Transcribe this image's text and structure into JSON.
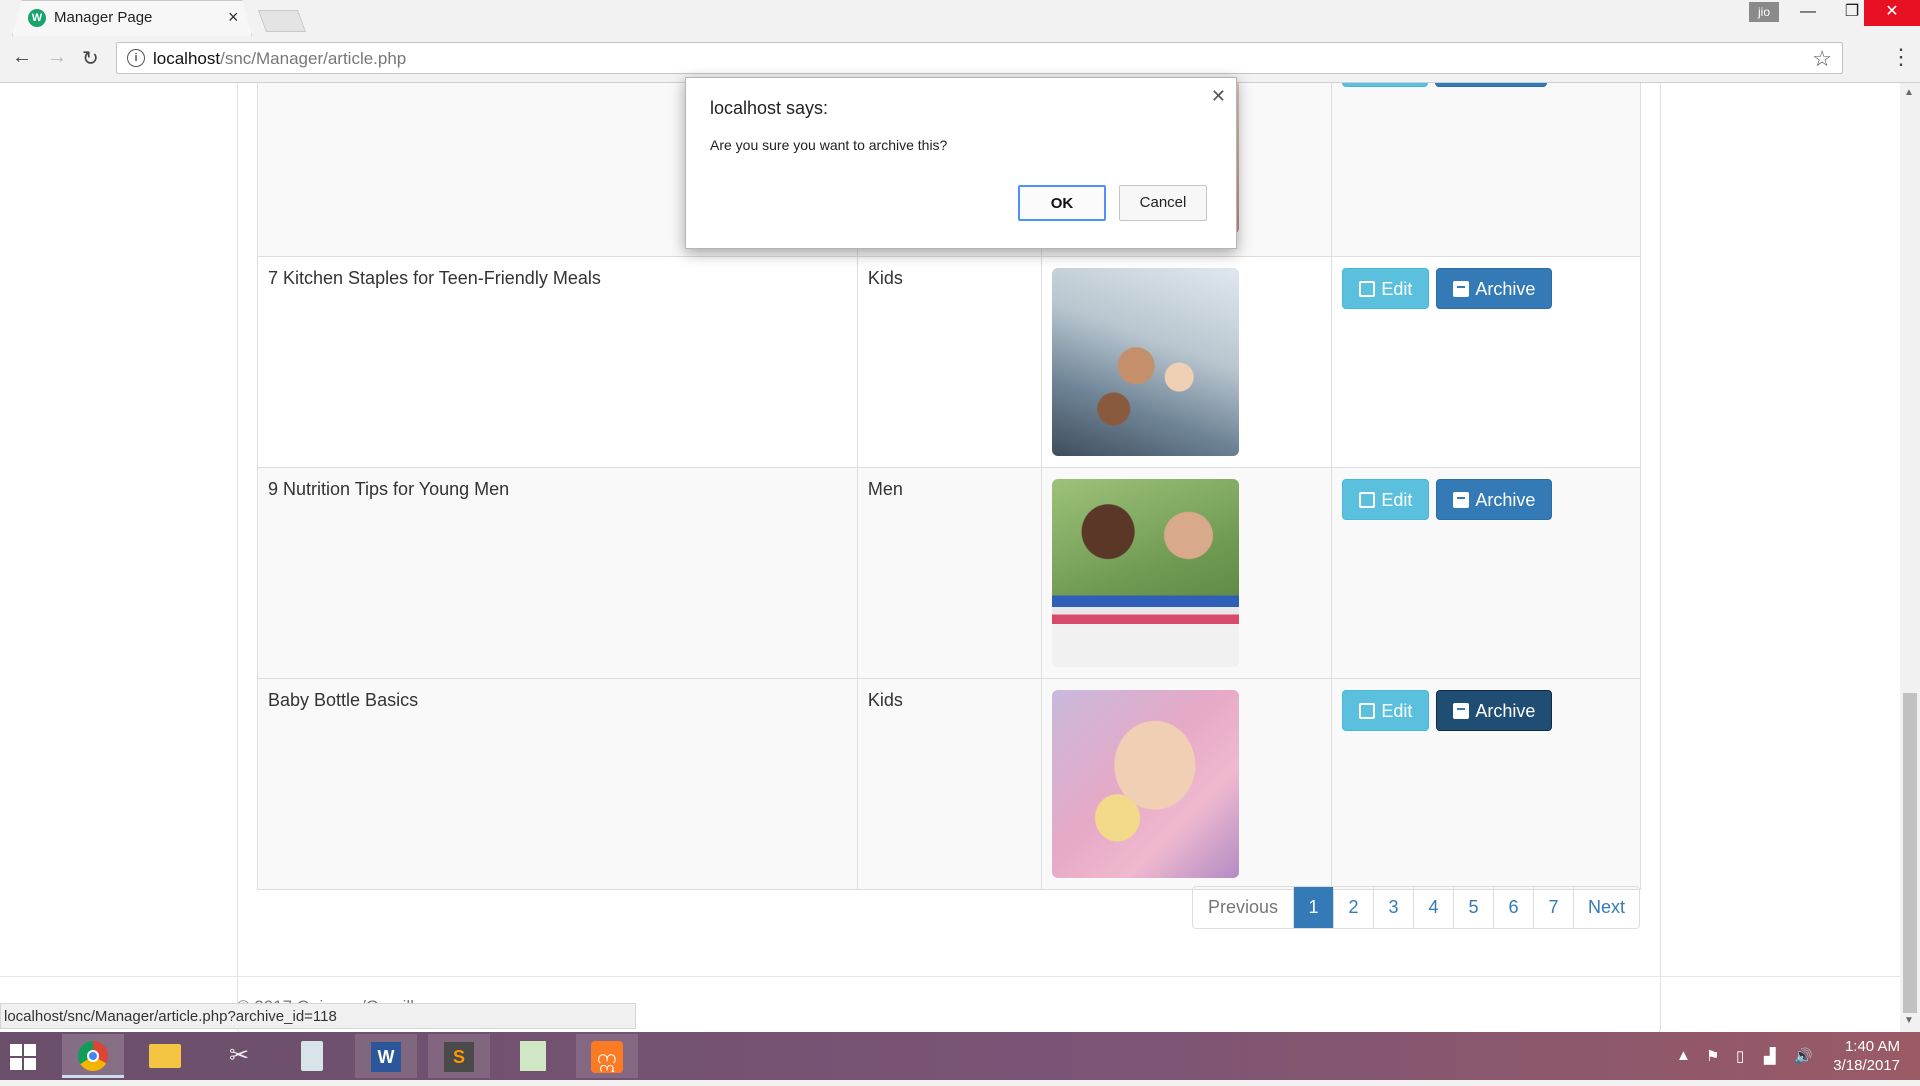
{
  "browser": {
    "tab_title": "Manager Page",
    "tab_favicon": "W",
    "url_host": "localhost",
    "url_path": "/snc/Manager/article.php",
    "profile_label": "jio",
    "status_url": "localhost/snc/Manager/article.php?archive_id=118"
  },
  "dialog": {
    "title": "localhost says:",
    "message": "Are you sure you want to archive this?",
    "ok_label": "OK",
    "cancel_label": "Cancel"
  },
  "table": {
    "rows": [
      {
        "title": "",
        "category": "",
        "image": "partial-thumbnail"
      },
      {
        "title": "7 Kitchen Staples for Teen-Friendly Meals",
        "category": "Kids",
        "image": "teens-in-kitchen"
      },
      {
        "title": "9 Nutrition Tips for Young Men",
        "category": "Men",
        "image": "two-young-men"
      },
      {
        "title": "Baby Bottle Basics",
        "category": "Kids",
        "image": "baby-with-bottle"
      }
    ],
    "edit_label": "Edit",
    "archive_label": "Archive"
  },
  "pagination": {
    "previous": "Previous",
    "pages": [
      "1",
      "2",
      "3",
      "4",
      "5",
      "6",
      "7"
    ],
    "active_page": "1",
    "next": "Next"
  },
  "footer": {
    "text": "© 2017 Quiagon/Grasilla"
  },
  "taskbar": {
    "apps": [
      "windows-start-icon",
      "chrome-icon",
      "file-explorer-icon",
      "snipping-tool-icon",
      "calculator-icon",
      "word-icon",
      "sublime-text-icon",
      "notepad-icon",
      "xampp-icon"
    ],
    "time": "1:40 AM",
    "date": "3/18/2017"
  },
  "colors": {
    "primary": "#337ab7",
    "info": "#5bc0de",
    "close_red": "#e81123"
  }
}
